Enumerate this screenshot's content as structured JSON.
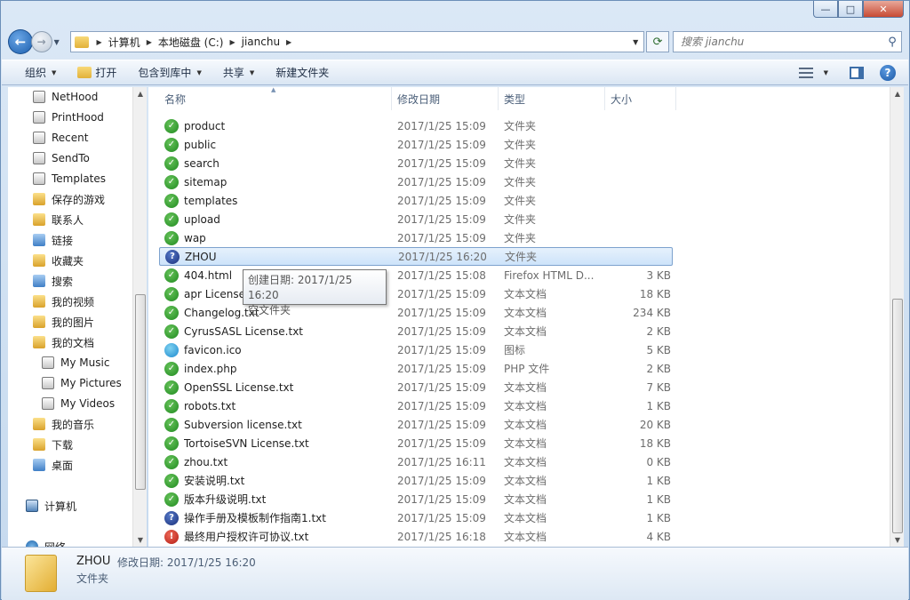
{
  "window": {
    "caption": {
      "minimize": "—",
      "maximize": "□",
      "close": "✕"
    }
  },
  "address": {
    "crumbs": [
      "计算机",
      "本地磁盘 (C:)",
      "jianchu"
    ]
  },
  "search": {
    "placeholder": "搜索 jianchu"
  },
  "toolbar": {
    "organize": "组织",
    "open": "打开",
    "include_in_library": "包含到库中",
    "share": "共享",
    "new_folder": "新建文件夹"
  },
  "navpane": {
    "items": [
      {
        "label": "NetHood",
        "icon": "shortcut-folder-icon"
      },
      {
        "label": "PrintHood",
        "icon": "shortcut-folder-icon"
      },
      {
        "label": "Recent",
        "icon": "recent-folder-icon"
      },
      {
        "label": "SendTo",
        "icon": "shortcut-folder-icon"
      },
      {
        "label": "Templates",
        "icon": "shortcut-folder-icon"
      },
      {
        "label": "保存的游戏",
        "icon": "folder-icon"
      },
      {
        "label": "联系人",
        "icon": "contacts-folder-icon"
      },
      {
        "label": "链接",
        "icon": "links-folder-icon"
      },
      {
        "label": "收藏夹",
        "icon": "favorites-folder-icon"
      },
      {
        "label": "搜索",
        "icon": "search-folder-icon"
      },
      {
        "label": "我的视频",
        "icon": "videos-folder-icon"
      },
      {
        "label": "我的图片",
        "icon": "pictures-folder-icon"
      },
      {
        "label": "我的文档",
        "icon": "documents-folder-icon"
      },
      {
        "label": "My Music",
        "icon": "music-folder-icon"
      },
      {
        "label": "My Pictures",
        "icon": "pictures-folder-icon"
      },
      {
        "label": "My Videos",
        "icon": "videos-folder-icon"
      },
      {
        "label": "我的音乐",
        "icon": "music-folder-icon"
      },
      {
        "label": "下载",
        "icon": "downloads-folder-icon"
      },
      {
        "label": "桌面",
        "icon": "desktop-folder-icon"
      },
      {
        "label": "计算机",
        "icon": "computer-icon"
      },
      {
        "label": "网络",
        "icon": "network-icon"
      }
    ]
  },
  "columns": {
    "name": "名称",
    "date": "修改日期",
    "type": "类型",
    "size": "大小"
  },
  "files": [
    {
      "name": "product",
      "date": "2017/1/25 15:09",
      "type": "文件夹",
      "size": "",
      "status": "ok"
    },
    {
      "name": "public",
      "date": "2017/1/25 15:09",
      "type": "文件夹",
      "size": "",
      "status": "ok"
    },
    {
      "name": "search",
      "date": "2017/1/25 15:09",
      "type": "文件夹",
      "size": "",
      "status": "ok"
    },
    {
      "name": "sitemap",
      "date": "2017/1/25 15:09",
      "type": "文件夹",
      "size": "",
      "status": "ok"
    },
    {
      "name": "templates",
      "date": "2017/1/25 15:09",
      "type": "文件夹",
      "size": "",
      "status": "ok"
    },
    {
      "name": "upload",
      "date": "2017/1/25 15:09",
      "type": "文件夹",
      "size": "",
      "status": "ok"
    },
    {
      "name": "wap",
      "date": "2017/1/25 15:09",
      "type": "文件夹",
      "size": "",
      "status": "ok"
    },
    {
      "name": "ZHOU",
      "date": "2017/1/25 16:20",
      "type": "文件夹",
      "size": "",
      "status": "unversioned"
    },
    {
      "name": "404.html",
      "date": "2017/1/25 15:08",
      "type": "Firefox HTML D...",
      "size": "3 KB",
      "status": "ok"
    },
    {
      "name": "apr License",
      "date": "2017/1/25 15:09",
      "type": "文本文档",
      "size": "18 KB",
      "status": "ok"
    },
    {
      "name": "Changelog.txt",
      "date": "2017/1/25 15:09",
      "type": "文本文档",
      "size": "234 KB",
      "status": "ok"
    },
    {
      "name": "CyrusSASL License.txt",
      "date": "2017/1/25 15:09",
      "type": "文本文档",
      "size": "2 KB",
      "status": "ok"
    },
    {
      "name": "favicon.ico",
      "date": "2017/1/25 15:09",
      "type": "图标",
      "size": "5 KB",
      "status": "icon"
    },
    {
      "name": "index.php",
      "date": "2017/1/25 15:09",
      "type": "PHP 文件",
      "size": "2 KB",
      "status": "ok"
    },
    {
      "name": "OpenSSL License.txt",
      "date": "2017/1/25 15:09",
      "type": "文本文档",
      "size": "7 KB",
      "status": "ok"
    },
    {
      "name": "robots.txt",
      "date": "2017/1/25 15:09",
      "type": "文本文档",
      "size": "1 KB",
      "status": "ok"
    },
    {
      "name": "Subversion license.txt",
      "date": "2017/1/25 15:09",
      "type": "文本文档",
      "size": "20 KB",
      "status": "ok"
    },
    {
      "name": "TortoiseSVN License.txt",
      "date": "2017/1/25 15:09",
      "type": "文本文档",
      "size": "18 KB",
      "status": "ok"
    },
    {
      "name": "zhou.txt",
      "date": "2017/1/25 16:11",
      "type": "文本文档",
      "size": "0 KB",
      "status": "ok"
    },
    {
      "name": "安装说明.txt",
      "date": "2017/1/25 15:09",
      "type": "文本文档",
      "size": "1 KB",
      "status": "ok"
    },
    {
      "name": "版本升级说明.txt",
      "date": "2017/1/25 15:09",
      "type": "文本文档",
      "size": "1 KB",
      "status": "ok"
    },
    {
      "name": "操作手册及模板制作指南1.txt",
      "date": "2017/1/25 15:09",
      "type": "文本文档",
      "size": "1 KB",
      "status": "unversioned"
    },
    {
      "name": "最终用户授权许可协议.txt",
      "date": "2017/1/25 16:18",
      "type": "文本文档",
      "size": "4 KB",
      "status": "modified"
    }
  ],
  "tooltip": {
    "line1": "创建日期: 2017/1/25 16:20",
    "line2": "空文件夹"
  },
  "details": {
    "name": "ZHOU",
    "meta": "修改日期: 2017/1/25 16:20",
    "type": "文件夹"
  }
}
